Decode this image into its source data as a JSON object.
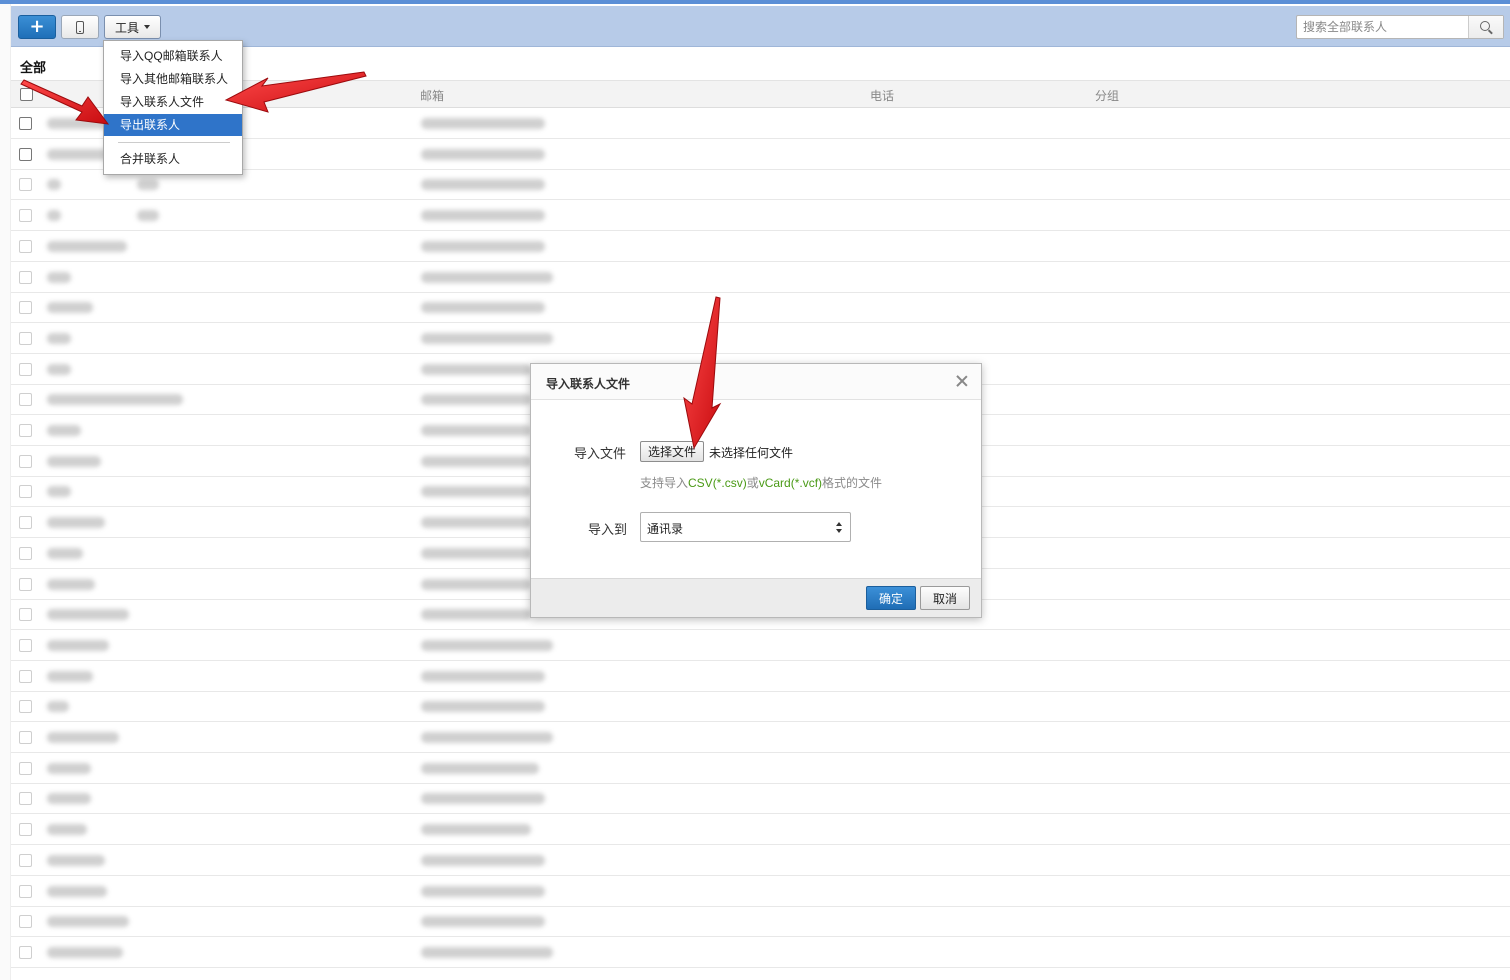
{
  "toolbar": {
    "add_label": "+",
    "tools_label": "工具",
    "search_placeholder": "搜索全部联系人",
    "icons": [
      "plus-icon",
      "phone-icon",
      "caret-down-icon",
      "search-icon"
    ]
  },
  "group_title": "全部",
  "columns": {
    "email": "邮箱",
    "phone": "电话",
    "group": "分组"
  },
  "tools_menu": {
    "items": [
      "导入QQ邮箱联系人",
      "导入其他邮箱联系人",
      "导入联系人文件",
      "导出联系人",
      "合并联系人"
    ],
    "active_item": "导出联系人"
  },
  "dialog": {
    "title": "导入联系人文件",
    "file_label": "导入文件",
    "choose_file_button": "选择文件",
    "file_status": "未选择任何文件",
    "hint_prefix": "支持导入",
    "hint_csv": "CSV(*.csv)",
    "hint_or": "或",
    "hint_vcf": "vCard(*.vcf)",
    "hint_suffix": "格式的文件",
    "target_label": "导入到",
    "target_value": "通讯录",
    "ok_button": "确定",
    "cancel_button": "取消"
  },
  "contact_rows_count": 28,
  "accent_color": "#2f74c9",
  "annotation_arrow_color": "#e8141b"
}
